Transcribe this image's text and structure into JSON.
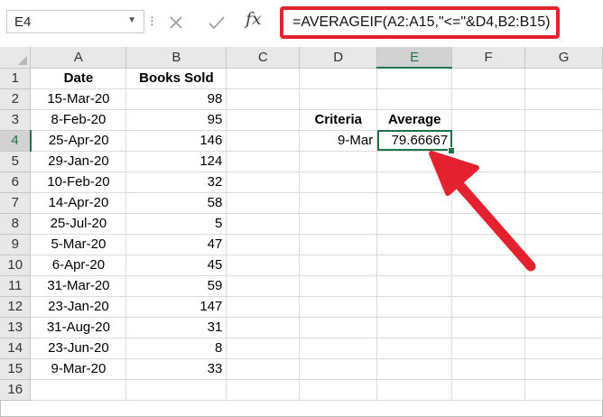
{
  "name_box": {
    "value": "E4",
    "dropdown_icon": "chevron-down-icon"
  },
  "formula_bar": {
    "cancel_icon": "close-icon",
    "enter_icon": "checkmark-icon",
    "function_label": "fx",
    "formula": "=AVERAGEIF(A2:A15,\"<=\"&D4,B2:B15)"
  },
  "columns": [
    "A",
    "B",
    "C",
    "D",
    "E",
    "F",
    "G"
  ],
  "rows": [
    "1",
    "2",
    "3",
    "4",
    "5",
    "6",
    "7",
    "8",
    "9",
    "10",
    "11",
    "12",
    "13",
    "14",
    "15",
    "16"
  ],
  "cells": {
    "A1": "Date",
    "B1": "Books Sold",
    "A2": "15-Mar-20",
    "B2": "98",
    "A3": "8-Feb-20",
    "B3": "95",
    "A4": "25-Apr-20",
    "B4": "146",
    "A5": "29-Jan-20",
    "B5": "124",
    "A6": "10-Feb-20",
    "B6": "32",
    "A7": "14-Apr-20",
    "B7": "58",
    "A8": "25-Jul-20",
    "B8": "5",
    "A9": "5-Mar-20",
    "B9": "47",
    "A10": "6-Apr-20",
    "B10": "45",
    "A11": "31-Mar-20",
    "B11": "59",
    "A12": "23-Jan-20",
    "B12": "147",
    "A13": "31-Aug-20",
    "B13": "31",
    "A14": "23-Jun-20",
    "B14": "8",
    "A15": "9-Mar-20",
    "B15": "33",
    "D3": "Criteria",
    "E3": "Average",
    "D4": "9-Mar",
    "E4": "79.66667"
  },
  "selected_cell": "E4",
  "colors": {
    "accent": "#217346",
    "highlight": "#e3212f"
  }
}
